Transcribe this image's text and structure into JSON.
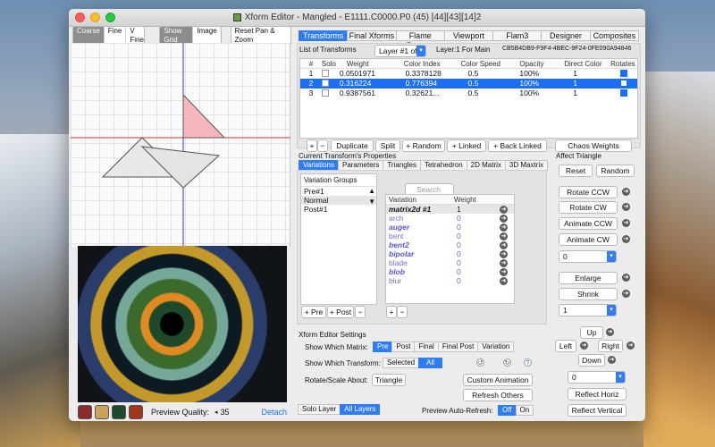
{
  "window": {
    "title": "Xform Editor - Mangled - E1111.C0000.P0 (45) [44][43][14]2"
  },
  "left_toolbar": {
    "grain": [
      "Coarse",
      "Fine",
      "V Fine"
    ],
    "grain_selected": "Coarse",
    "view": [
      "Show Grid",
      "Image"
    ],
    "view_selected": "Show Grid",
    "reset_label": "Reset Pan & Zoom"
  },
  "preview_controls": {
    "quality_label": "Preview Quality:",
    "quality_value": "35",
    "detach_label": "Detach"
  },
  "main_tabs": [
    "Transforms",
    "Final Xforms",
    "Flame Params",
    "Viewport",
    "Flam3",
    "Designer",
    "Composites"
  ],
  "main_tab_selected": "Transforms",
  "transforms": {
    "list_label": "List of Transforms",
    "layer_select": "Layer #1 of 1",
    "layer_main": "Layer:1 For Main",
    "uuid": "CB5B4DB9-F9F4-4BEC-9F24-0FE090A94846",
    "columns": [
      "#",
      "Solo",
      "Weight",
      "Color Index",
      "Color Speed",
      "Opacity",
      "Direct Color",
      "Rotates"
    ],
    "rows": [
      {
        "num": "1",
        "weight": "0.0501971",
        "color_index": "0.3378128",
        "color_speed": "0.5",
        "opacity": "100%",
        "direct": "1"
      },
      {
        "num": "2",
        "weight": "0.316224",
        "color_index": "0.776394",
        "color_speed": "0.5",
        "opacity": "100%",
        "direct": "1"
      },
      {
        "num": "3",
        "weight": "0.9387561",
        "color_index": "0.32621...",
        "color_speed": "0.5",
        "opacity": "100%",
        "direct": "1"
      }
    ],
    "buttons": [
      "+",
      "−",
      "Duplicate",
      "Split",
      "+ Random",
      "+ Linked",
      "+ Back Linked"
    ],
    "chaos_label": "Chaos Weights"
  },
  "current_props": {
    "label": "Current Transform's Properties",
    "tabs": [
      "Variations",
      "Parameters",
      "Triangles",
      "Tetrahedron",
      "2D Matrix",
      "3D Maxtrix"
    ],
    "tab_selected": "Variations",
    "groups_label": "Variation Groups",
    "groups": [
      "Pre#1",
      "Normal",
      "Post#1"
    ],
    "group_selected": "Normal",
    "group_buttons": [
      "+ Pre",
      "+ Post",
      "−"
    ],
    "search_placeholder": "Search",
    "var_columns": [
      "Variation",
      "Weight"
    ],
    "variations": [
      {
        "name": "matrix2d #1",
        "weight": "1"
      },
      {
        "name": "arch",
        "weight": "0"
      },
      {
        "name": "auger",
        "weight": "0"
      },
      {
        "name": "bent",
        "weight": "0"
      },
      {
        "name": "bent2",
        "weight": "0"
      },
      {
        "name": "bipolar",
        "weight": "0"
      },
      {
        "name": "blade",
        "weight": "0"
      },
      {
        "name": "blob",
        "weight": "0"
      },
      {
        "name": "blur",
        "weight": "0"
      }
    ],
    "var_buttons": [
      "+",
      "−"
    ]
  },
  "affect_triangle": {
    "label": "Affect Triangle",
    "reset": "Reset",
    "random": "Random",
    "rotate_ccw": "Rotate CCW",
    "rotate_cw": "Rotate CW",
    "animate_ccw": "Animate CCW",
    "animate_cw": "Animate CW",
    "rotate_value": "0",
    "enlarge": "Enlarge",
    "shrink": "Shrink",
    "scale_value": "1",
    "up": "Up",
    "left": "Left",
    "right": "Right",
    "down": "Down",
    "move_value": "0",
    "reflect_h": "Reflect Horiz",
    "reflect_v": "Reflect Vertical"
  },
  "settings": {
    "label": "Xform Editor Settings",
    "matrix_label": "Show Which Matrix:",
    "matrix_opts": [
      "Pre",
      "Post",
      "Final",
      "Final Post",
      "Variation"
    ],
    "matrix_selected": "Pre",
    "transform_label": "Show Which Transform:",
    "transform_opts": [
      "Selected",
      "All"
    ],
    "transform_selected": "All",
    "rotate_label": "Rotate/Scale About:",
    "rotate_value": "Triangle",
    "custom_anim": "Custom Animation",
    "refresh": "Refresh Others",
    "help": "?",
    "layer_opts": [
      "Solo Layer",
      "All Layers"
    ],
    "layer_selected": "All Layers",
    "auto_refresh_label": "Preview Auto-Refresh:",
    "auto_opts": [
      "Off",
      "On"
    ],
    "auto_selected": "Off"
  },
  "colors": {
    "accent": "#2f7df6",
    "selection": "#1b6ff3",
    "triangle_pink": "#f6b8bc"
  }
}
